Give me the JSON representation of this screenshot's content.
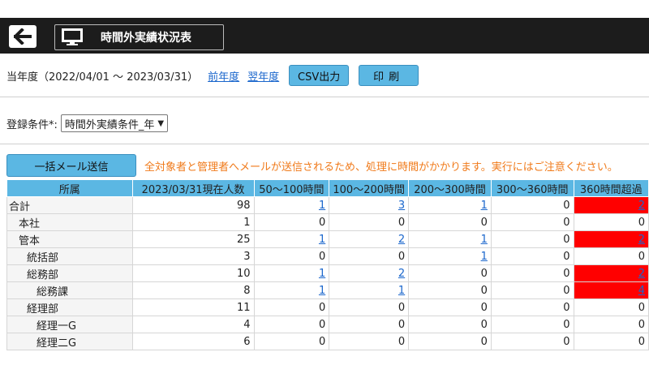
{
  "header": {
    "title": "時間外実績状況表",
    "back_icon": "back-arrow-icon",
    "screen_icon": "monitor-icon"
  },
  "yearbar": {
    "period": "当年度（2022/04/01 〜 2023/03/31）",
    "prev_label": "前年度",
    "next_label": "翌年度",
    "csv_label": "CSV出力",
    "print_label": "印刷"
  },
  "condition": {
    "label": "登録条件*:",
    "selected": "時間外実績条件_年"
  },
  "mail": {
    "button_label": "一括メール送信",
    "warning": "全対象者と管理者へメールが送信されるため、処理に時間がかかります。実行にはご注意ください。"
  },
  "table": {
    "headers": [
      "所属",
      "2023/03/31現在人数",
      "50〜100時間",
      "100〜200時間",
      "200〜300時間",
      "300〜360時間",
      "360時間超過"
    ],
    "rows": [
      {
        "name": "合計",
        "level": 0,
        "values": [
          "98",
          "1",
          "3",
          "1",
          "0",
          "2"
        ],
        "links": [
          false,
          true,
          true,
          true,
          false,
          true
        ],
        "red": [
          false,
          false,
          false,
          false,
          false,
          true
        ]
      },
      {
        "name": "本社",
        "level": 1,
        "values": [
          "1",
          "0",
          "0",
          "0",
          "0",
          "0"
        ],
        "links": [
          false,
          false,
          false,
          false,
          false,
          false
        ],
        "red": [
          false,
          false,
          false,
          false,
          false,
          false
        ]
      },
      {
        "name": "管本",
        "level": 1,
        "values": [
          "25",
          "1",
          "2",
          "1",
          "0",
          "2"
        ],
        "links": [
          false,
          true,
          true,
          true,
          false,
          true
        ],
        "red": [
          false,
          false,
          false,
          false,
          false,
          true
        ]
      },
      {
        "name": "統括部",
        "level": 2,
        "values": [
          "3",
          "0",
          "0",
          "1",
          "0",
          "0"
        ],
        "links": [
          false,
          false,
          false,
          true,
          false,
          false
        ],
        "red": [
          false,
          false,
          false,
          false,
          false,
          false
        ]
      },
      {
        "name": "総務部",
        "level": 2,
        "values": [
          "10",
          "1",
          "2",
          "0",
          "0",
          "2"
        ],
        "links": [
          false,
          true,
          true,
          false,
          false,
          true
        ],
        "red": [
          false,
          false,
          false,
          false,
          false,
          true
        ]
      },
      {
        "name": "総務課",
        "level": 3,
        "values": [
          "8",
          "1",
          "1",
          "0",
          "0",
          "4"
        ],
        "links": [
          false,
          true,
          true,
          false,
          false,
          true
        ],
        "red": [
          false,
          false,
          false,
          false,
          false,
          true
        ]
      },
      {
        "name": "経理部",
        "level": 2,
        "values": [
          "11",
          "0",
          "0",
          "0",
          "0",
          "0"
        ],
        "links": [
          false,
          false,
          false,
          false,
          false,
          false
        ],
        "red": [
          false,
          false,
          false,
          false,
          false,
          false
        ]
      },
      {
        "name": "経理一G",
        "level": 3,
        "values": [
          "4",
          "0",
          "0",
          "0",
          "0",
          "0"
        ],
        "links": [
          false,
          false,
          false,
          false,
          false,
          false
        ],
        "red": [
          false,
          false,
          false,
          false,
          false,
          false
        ]
      },
      {
        "name": "経理二G",
        "level": 3,
        "values": [
          "6",
          "0",
          "0",
          "0",
          "0",
          "0"
        ],
        "links": [
          false,
          false,
          false,
          false,
          false,
          false
        ],
        "red": [
          false,
          false,
          false,
          false,
          false,
          false
        ]
      }
    ]
  }
}
